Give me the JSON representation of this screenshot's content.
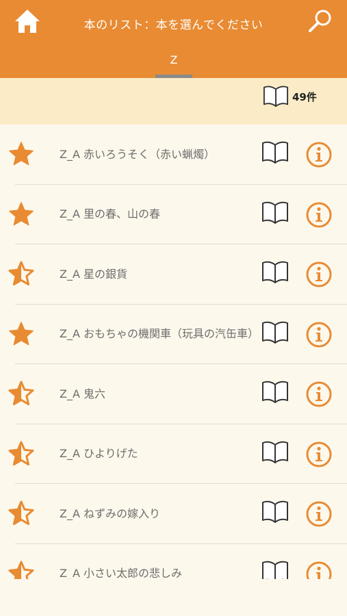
{
  "header": {
    "title": "本のリスト：本を選んでください",
    "home_icon": "home-icon",
    "search_icon": "search-icon",
    "tab": "Z",
    "bg_color": "#e88b33"
  },
  "count": {
    "text": "49件",
    "icon": "open-book-icon"
  },
  "books": [
    {
      "title": "Z_A 赤いろうそく（赤い蝋燭）",
      "rating": "full"
    },
    {
      "title": "Z_A 里の春、山の春",
      "rating": "full"
    },
    {
      "title": "Z_A 星の銀貨",
      "rating": "half"
    },
    {
      "title": "Z_A おもちゃの機関車（玩具の汽缶車）",
      "rating": "full"
    },
    {
      "title": "Z_A 鬼六",
      "rating": "half"
    },
    {
      "title": "Z_A ひよりげた",
      "rating": "half"
    },
    {
      "title": "Z_A ねずみの嫁入り",
      "rating": "half"
    },
    {
      "title": "Z_A 小さい太郎の悲しみ",
      "rating": "half"
    }
  ],
  "colors": {
    "accent": "#e88b33",
    "countbar": "#fbecc7",
    "background": "#fdf8ec"
  }
}
